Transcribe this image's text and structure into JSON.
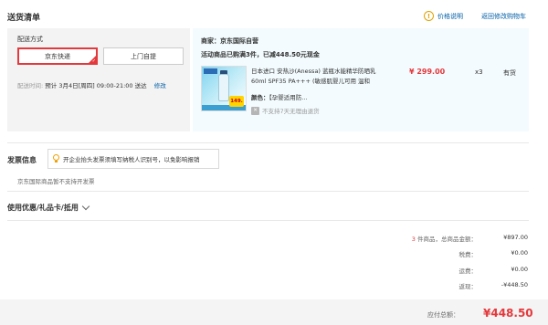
{
  "header": {
    "title": "送货清单",
    "price_note": "价格说明",
    "back_to_cart": "返回修改购物车"
  },
  "delivery": {
    "label": "配送方式",
    "option_jd": "京东快递",
    "option_self": "上门自提",
    "time_label": "配送时间:",
    "time_value": "预计 3月4日[周四] 09:00-21:00 送达",
    "edit": "修改"
  },
  "merchant": {
    "name": "商家：京东国际自营",
    "promo": "活动商品已购满3件，已减448.50元现金"
  },
  "product": {
    "name": "日本进口 安热沙(Anessa) 蓝瓶水能精华防晒乳60ml SPF35 PA+++ (敏感肌婴儿可用 温和",
    "color_key": "颜色：",
    "color_value": "【孕婴适用防...",
    "no_return": "不支持7天无理由退货",
    "price": "¥ 299.00",
    "qty": "x3",
    "stock": "有货",
    "badge": "149."
  },
  "invoice": {
    "title": "发票信息",
    "tip": "开企业抬头发票须填写纳税人识别号，以免影响报销",
    "note": "京东国际商品暂不支持开发票"
  },
  "discount": {
    "title": "使用优惠/礼品卡/抵用"
  },
  "summary": {
    "count": "3",
    "count_suffix": " 件商品，总商品金额：",
    "goods_total": "¥897.00",
    "tax_label": "税费：",
    "tax": "¥0.00",
    "shipping_label": "运费：",
    "shipping": "¥0.00",
    "refund_label": "返现：",
    "refund": "-¥448.50",
    "payable_label": "应付总额：",
    "payable": "¥448.50"
  },
  "colors": {
    "accent": "#e4393c",
    "link": "#005ea7"
  }
}
